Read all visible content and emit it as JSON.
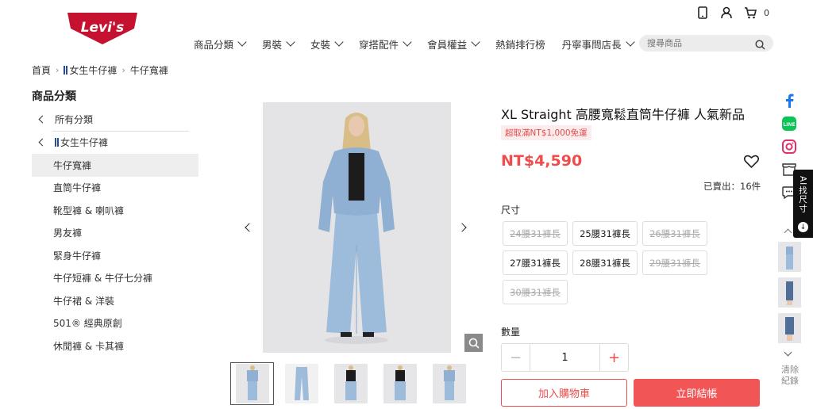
{
  "brand": {
    "logo_text": "Levi's",
    "logo_color": "#c41230"
  },
  "header": {
    "cart_count": "0",
    "nav": [
      {
        "label": "商品分類",
        "has_dropdown": true
      },
      {
        "label": "男裝",
        "has_dropdown": true
      },
      {
        "label": "女裝",
        "has_dropdown": true
      },
      {
        "label": "穿搭配件",
        "has_dropdown": true
      },
      {
        "label": "會員權益",
        "has_dropdown": true
      },
      {
        "label": "熱銷排行榜",
        "has_dropdown": false
      },
      {
        "label": "丹寧事問店長",
        "has_dropdown": true
      }
    ],
    "search_placeholder": "搜尋商品"
  },
  "breadcrumb": {
    "home": "首頁",
    "parent": "女生牛仔褲",
    "current": "牛仔寬褲"
  },
  "sidebar": {
    "title": "商品分類",
    "back_all": "所有分類",
    "back_parent": "女生牛仔褲",
    "items": [
      {
        "label": "牛仔寬褲",
        "active": true
      },
      {
        "label": "直筒牛仔褲",
        "active": false
      },
      {
        "label": "靴型褲 & 喇叭褲",
        "active": false
      },
      {
        "label": "男友褲",
        "active": false
      },
      {
        "label": "緊身牛仔褲",
        "active": false
      },
      {
        "label": "牛仔短褲 & 牛仔七分褲",
        "active": false
      },
      {
        "label": "牛仔裙 & 洋裝",
        "active": false
      },
      {
        "label": "501® 經典原創",
        "active": false
      },
      {
        "label": "休閒褲 & 卡其褲",
        "active": false
      }
    ]
  },
  "gallery": {
    "thumbnail_count": 5,
    "selected_index": 0
  },
  "product": {
    "title": "XL Straight 高腰寬鬆直筒牛仔褲 人氣新品",
    "promo": "超取滿NT$1,000免運",
    "price": "NT$4,590",
    "sold": "已賣出：16件",
    "size_label": "尺寸",
    "sizes": [
      {
        "label": "24腰31褲長",
        "available": false
      },
      {
        "label": "25腰31褲長",
        "available": true
      },
      {
        "label": "26腰31褲長",
        "available": false
      },
      {
        "label": "27腰31褲長",
        "available": true
      },
      {
        "label": "28腰31褲長",
        "available": true
      },
      {
        "label": "29腰31褲長",
        "available": false
      },
      {
        "label": "30腰31褲長",
        "available": false
      }
    ],
    "qty_label": "數量",
    "qty_value": "1",
    "add_to_cart": "加入購物車",
    "buy_now": "立即結帳",
    "accent_color": "#ef4d4d"
  },
  "side_tools": {
    "ai_tab": "AI找尺寸",
    "clear_history": "清除紀錄"
  }
}
